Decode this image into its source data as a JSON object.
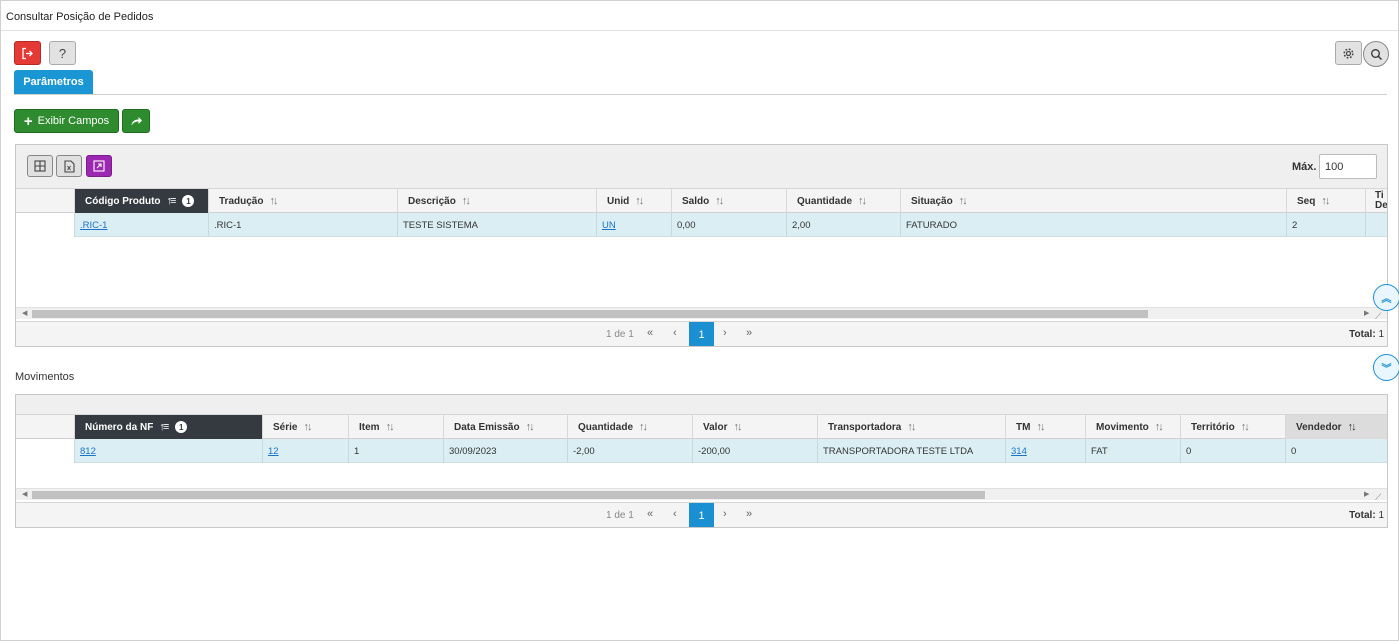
{
  "window": {
    "title": "Consultar Posição de Pedidos"
  },
  "toolbar": {
    "exit_icon": "exit-icon",
    "help_label": "?",
    "gear_icon": "gear-icon",
    "search_icon": "search-icon"
  },
  "tabs": [
    {
      "label": "Parâmetros"
    }
  ],
  "actions": {
    "exibir_label": "Exibir Campos"
  },
  "grid1": {
    "max_label": "Máx.",
    "max_value": "100",
    "columns": [
      {
        "label": "Código Produto",
        "badge": "1"
      },
      {
        "label": "Tradução"
      },
      {
        "label": "Descrição"
      },
      {
        "label": "Unid"
      },
      {
        "label": "Saldo"
      },
      {
        "label": "Quantidade"
      },
      {
        "label": "Situação"
      },
      {
        "label": "Seq"
      },
      {
        "label": "Ti",
        "label2": "De"
      }
    ],
    "rows": [
      {
        "codigo": ".RIC-1",
        "traducao": ".RIC-1",
        "descricao": "TESTE SISTEMA",
        "unid": "UN",
        "saldo": "0,00",
        "quantidade": "2,00",
        "situacao": "FATURADO",
        "seq": "2"
      }
    ],
    "pager": {
      "info": "1 de 1",
      "page": "1",
      "total_label": "Total:",
      "total_value": "1"
    }
  },
  "section2": {
    "label": "Movimentos"
  },
  "grid2": {
    "columns": [
      {
        "label": "Número da NF",
        "badge": "1"
      },
      {
        "label": "Série"
      },
      {
        "label": "Item"
      },
      {
        "label": "Data Emissão"
      },
      {
        "label": "Quantidade"
      },
      {
        "label": "Valor"
      },
      {
        "label": "Transportadora"
      },
      {
        "label": "TM"
      },
      {
        "label": "Movimento"
      },
      {
        "label": "Território"
      },
      {
        "label": "Vendedor"
      }
    ],
    "rows": [
      {
        "nf": "812",
        "serie": "12",
        "item": "1",
        "data": "30/09/2023",
        "quantidade": "-2,00",
        "valor": "-200,00",
        "transportadora": "TRANSPORTADORA TESTE  LTDA",
        "tm": "314",
        "movimento": "FAT",
        "territorio": "0",
        "vendedor": "0"
      }
    ],
    "pager": {
      "info": "1 de 1",
      "page": "1",
      "total_label": "Total:",
      "total_value": "1"
    }
  }
}
